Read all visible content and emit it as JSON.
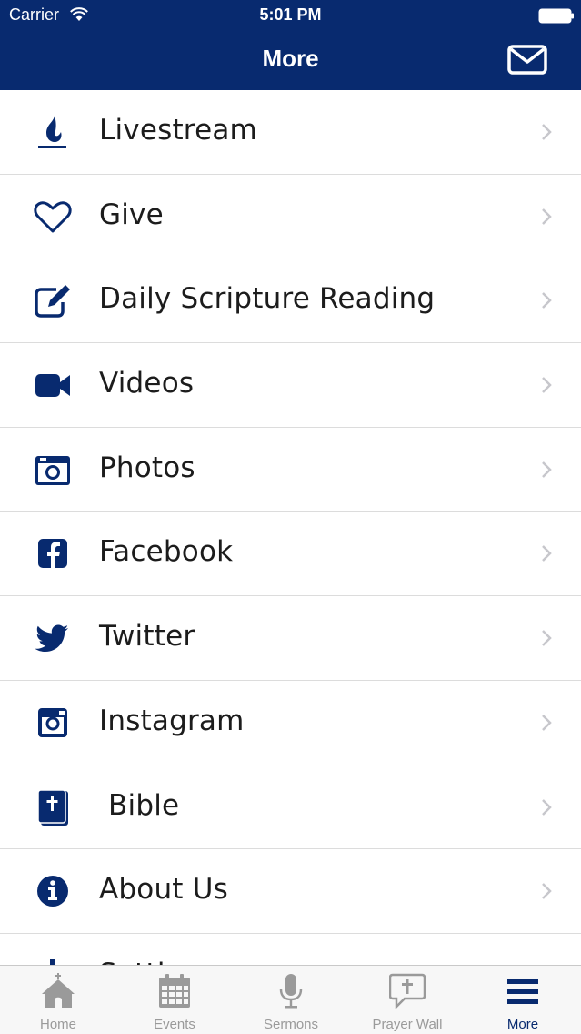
{
  "status_bar": {
    "carrier": "Carrier",
    "time": "5:01 PM"
  },
  "nav": {
    "title": "More"
  },
  "colors": {
    "brand": "#082a6f",
    "tab_inactive": "#9a9a9a",
    "separator": "#dcdcdc"
  },
  "menu": [
    {
      "label": "Livestream",
      "icon": "flame-icon"
    },
    {
      "label": "Give",
      "icon": "heart-icon"
    },
    {
      "label": "Daily Scripture Reading",
      "icon": "edit-icon"
    },
    {
      "label": "Videos",
      "icon": "video-camera-icon"
    },
    {
      "label": "Photos",
      "icon": "camera-icon"
    },
    {
      "label": "Facebook",
      "icon": "facebook-icon"
    },
    {
      "label": "Twitter",
      "icon": "twitter-icon"
    },
    {
      "label": "Instagram",
      "icon": "instagram-icon"
    },
    {
      "label": " Bible",
      "icon": "bible-icon"
    },
    {
      "label": "About Us",
      "icon": "info-icon"
    },
    {
      "label": "Settings",
      "icon": "gear-icon"
    }
  ],
  "tabs": [
    {
      "label": "Home",
      "icon": "church-icon"
    },
    {
      "label": "Events",
      "icon": "calendar-icon"
    },
    {
      "label": "Sermons",
      "icon": "microphone-icon"
    },
    {
      "label": "Prayer Wall",
      "icon": "prayer-bubble-icon"
    },
    {
      "label": "More",
      "icon": "hamburger-icon"
    }
  ]
}
